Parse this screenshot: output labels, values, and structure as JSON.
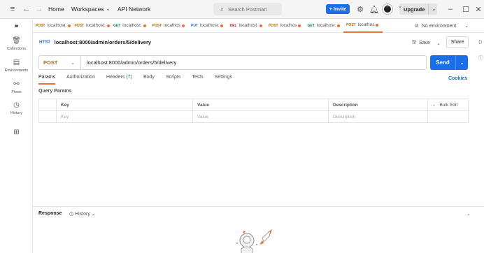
{
  "titlebar": {
    "home": "Home",
    "workspaces": "Workspaces",
    "api_network": "API Network",
    "search_placeholder": "Search Postman",
    "invite": "Invite",
    "upgrade": "Upgrade"
  },
  "sidebar": {
    "items": [
      {
        "label": "Collections",
        "icon": "trash-icon"
      },
      {
        "label": "Environments",
        "icon": "environment-icon"
      },
      {
        "label": "Flows",
        "icon": "flows-icon"
      },
      {
        "label": "History",
        "icon": "history-icon"
      },
      {
        "label": "",
        "icon": "grid-icon"
      }
    ]
  },
  "tabs": [
    {
      "method": "POST",
      "label": "localhost:",
      "color": "#b46a00"
    },
    {
      "method": "POST",
      "label": "localhost:",
      "color": "#b46a00"
    },
    {
      "method": "GET",
      "label": "localhost:",
      "color": "#0a8a3a"
    },
    {
      "method": "POST",
      "label": "localhos",
      "color": "#b46a00"
    },
    {
      "method": "PUT",
      "label": "localhost:",
      "color": "#1a6ee8"
    },
    {
      "method": "DEL",
      "label": "localhost:",
      "color": "#c22525"
    },
    {
      "method": "POST",
      "label": "localhos",
      "color": "#b46a00"
    },
    {
      "method": "GET",
      "label": "localhost:",
      "color": "#0a8a3a"
    },
    {
      "method": "POST",
      "label": "localhos",
      "color": "#b46a00"
    }
  ],
  "environment": "No environment",
  "request": {
    "badge": "HTTP",
    "title": "localhost:8000/admin/orders/5/delivery",
    "save": "Save",
    "share": "Share",
    "method": "POST",
    "url": "localhost:8000/admin/orders/5/delivery",
    "send": "Send",
    "subtabs": [
      "Params",
      "Authorization",
      "Headers",
      "Body",
      "Scripts",
      "Tests",
      "Settings"
    ],
    "headers_count": "(7)",
    "cookies": "Cookies"
  },
  "params": {
    "title": "Query Params",
    "columns": [
      "Key",
      "Value",
      "Description"
    ],
    "bulk_edit": "Bulk Edit",
    "placeholders": {
      "key": "Key",
      "value": "Value",
      "description": "Description"
    }
  },
  "response": {
    "title": "Response",
    "history": "History"
  }
}
